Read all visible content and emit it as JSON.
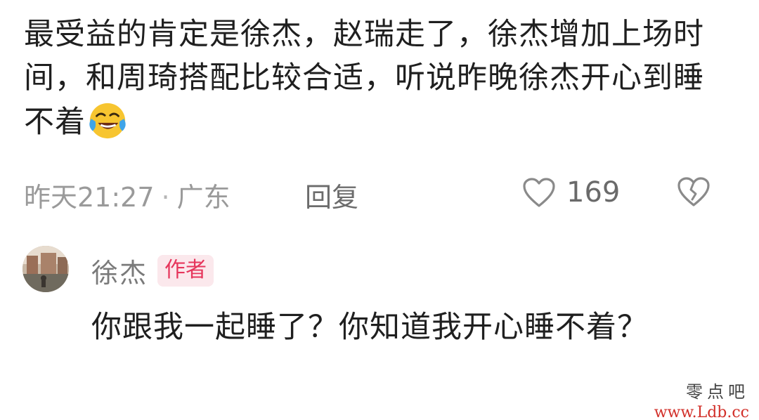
{
  "comment": {
    "text": "最受益的肯定是徐杰，赵瑞走了，徐杰增加上场时间，和周琦搭配比较合适，听说昨晚徐杰开心到睡不着",
    "emoji_icon": "laughing-tears-emoji-icon",
    "time": "昨天21:27",
    "separator": "·",
    "location": "广东",
    "reply_label": "回复",
    "like_icon": "heart-outline-icon",
    "like_count": "169",
    "dislike_icon": "broken-heart-icon"
  },
  "reply": {
    "author_name": "徐杰",
    "author_badge": "作者",
    "badge_color": "#e6365c",
    "text": "你跟我一起睡了？你知道我开心睡不着？"
  },
  "watermark": {
    "site_name": "零点吧",
    "url": "www.Ldb.cc"
  }
}
